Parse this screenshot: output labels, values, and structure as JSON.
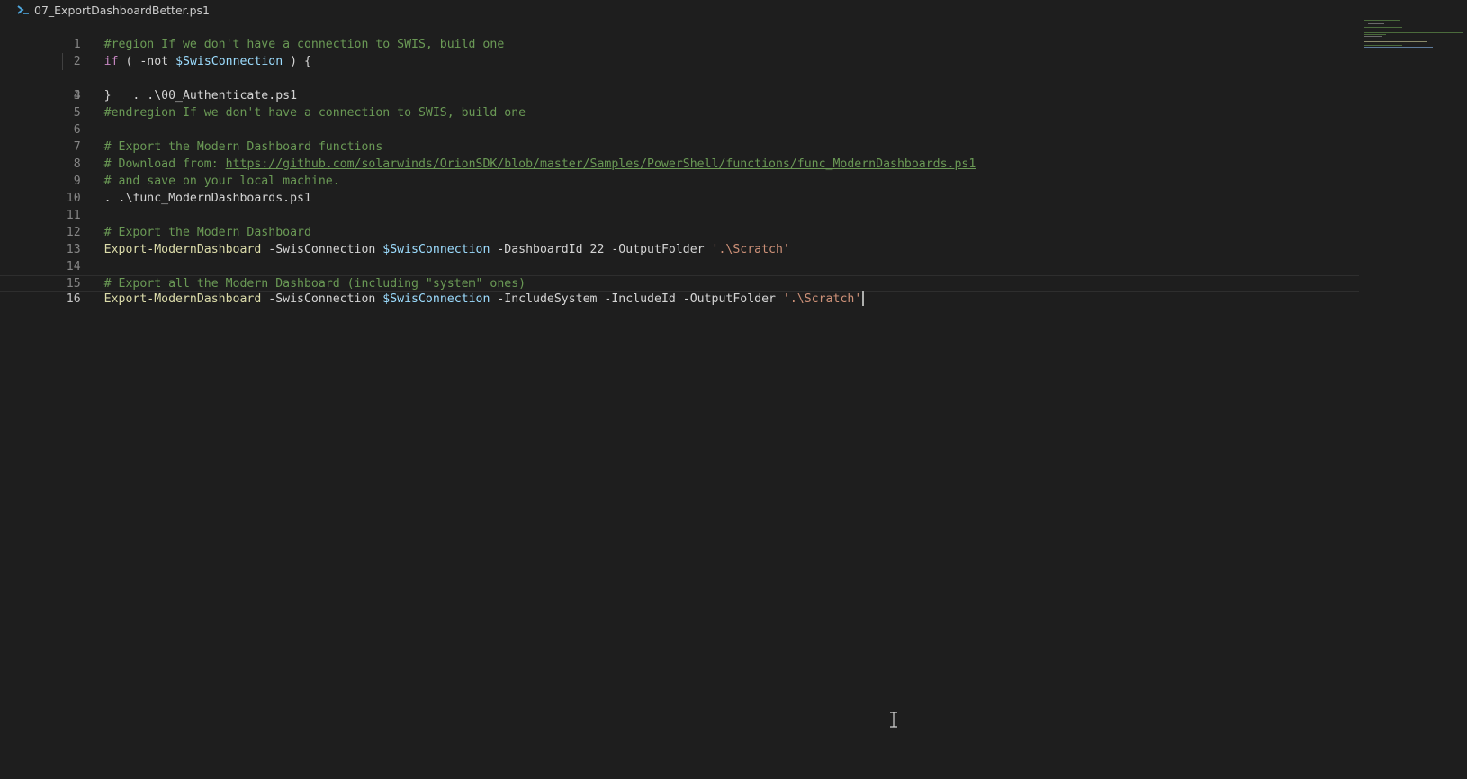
{
  "tab": {
    "filename": "07_ExportDashboardBetter.ps1",
    "icon": "powershell-icon"
  },
  "editor": {
    "lines": [
      {
        "n": "1",
        "text": "#region If we don't have a connection to SWIS, build one"
      },
      {
        "n": "2",
        "parts": [
          "if",
          " ( -not ",
          "$SwisConnection",
          " ) {"
        ]
      },
      {
        "n": "3",
        "text": "    . .\\00_Authenticate.ps1"
      },
      {
        "n": "4",
        "text": "}"
      },
      {
        "n": "5",
        "text": "#endregion If we don't have a connection to SWIS, build one"
      },
      {
        "n": "6",
        "text": ""
      },
      {
        "n": "7",
        "text": "# Export the Modern Dashboard functions"
      },
      {
        "n": "8",
        "parts": [
          "# Download from: ",
          "https://github.com/solarwinds/OrionSDK/blob/master/Samples/PowerShell/functions/func_ModernDashboards.ps1"
        ]
      },
      {
        "n": "9",
        "text": "# and save on your local machine."
      },
      {
        "n": "10",
        "text": ". .\\func_ModernDashboards.ps1"
      },
      {
        "n": "11",
        "text": ""
      },
      {
        "n": "12",
        "text": "# Export the Modern Dashboard"
      },
      {
        "n": "13",
        "parts": [
          "Export-ModernDashboard",
          " -SwisConnection ",
          "$SwisConnection",
          " -DashboardId 22 -OutputFolder ",
          "'.\\Scratch'"
        ]
      },
      {
        "n": "14",
        "text": ""
      },
      {
        "n": "15",
        "text": "# Export all the Modern Dashboard (including \"system\" ones)"
      },
      {
        "n": "16",
        "parts": [
          "Export-ModernDashboard",
          " -SwisConnection ",
          "$SwisConnection",
          " -IncludeSystem -IncludeId -OutputFolder ",
          "'.\\Scratch'"
        ]
      }
    ]
  },
  "colors": {
    "background": "#1e1e1e",
    "comment": "#6a9955",
    "keyword": "#c586c0",
    "variable": "#9cdcfe",
    "function": "#dcdcaa",
    "string": "#ce9178",
    "text": "#d4d4d4",
    "line_number": "#858585"
  }
}
